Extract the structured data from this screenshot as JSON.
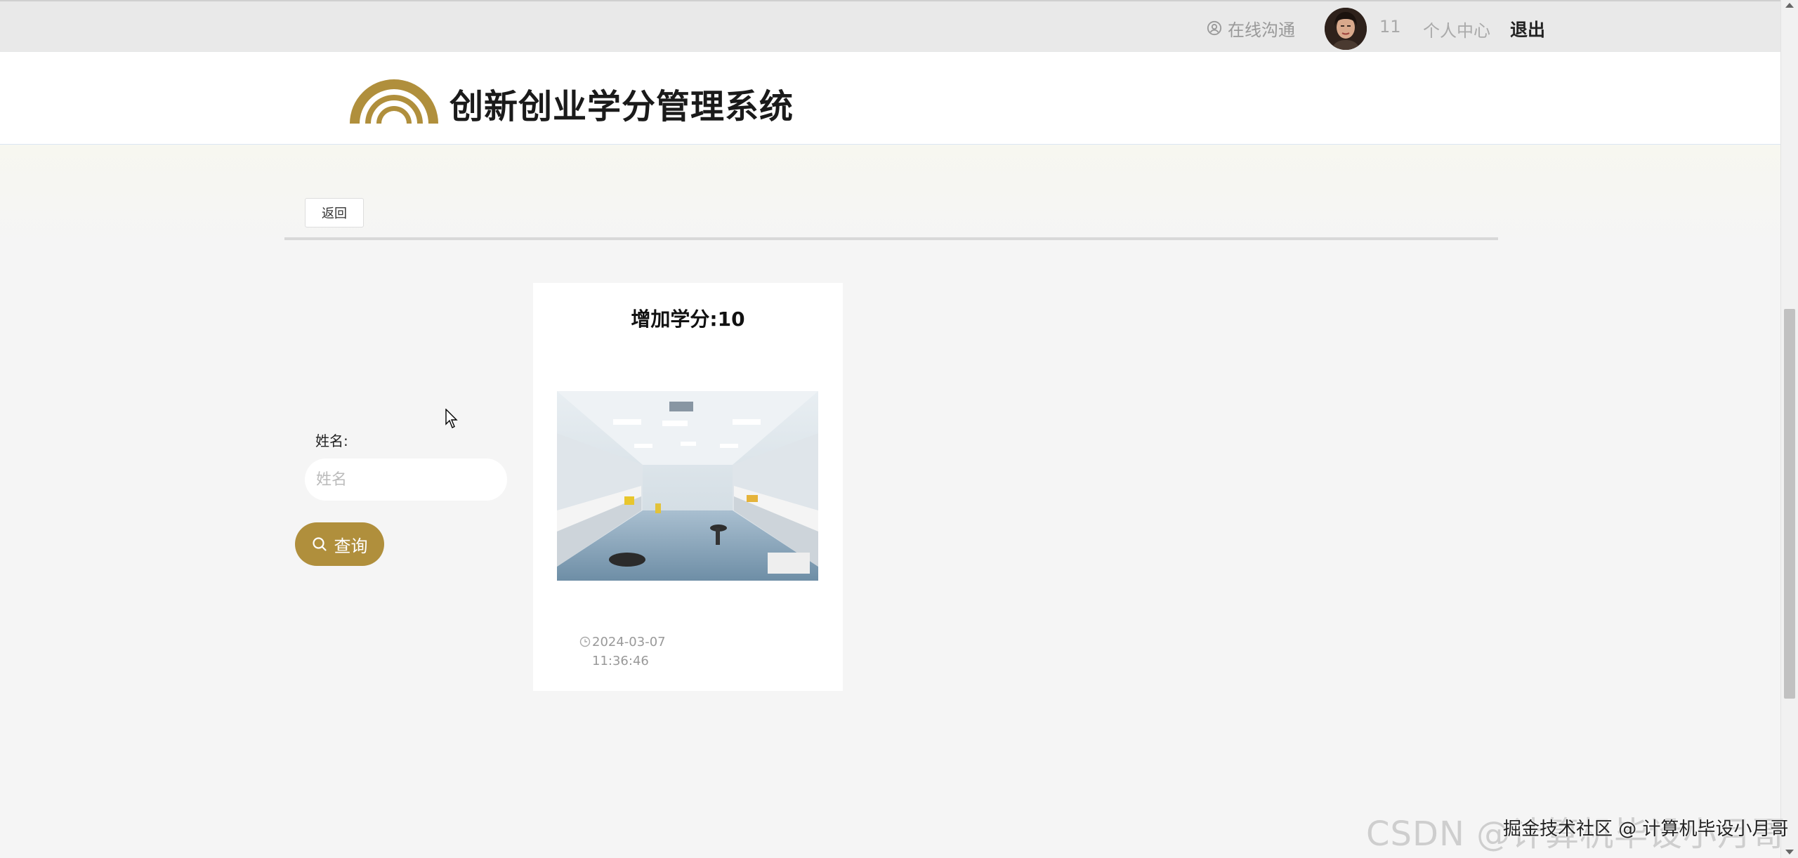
{
  "topbar": {
    "chat_label": "在线沟通",
    "username": "11",
    "center_label": "个人中心",
    "logout_label": "退出"
  },
  "header": {
    "site_title": "创新创业学分管理系统"
  },
  "toolbar": {
    "back_label": "返回"
  },
  "search": {
    "name_label": "姓名:",
    "name_placeholder": "姓名",
    "name_value": "",
    "query_label": "查询"
  },
  "card": {
    "title": "增加学分:10",
    "image_icon": "laboratory-photo",
    "date": "2024-03-07",
    "time": "11:36:46"
  },
  "watermark": {
    "large": "CSDN @计算机毕设小月哥",
    "small": "掘金技术社区 @ 计算机毕设小月哥"
  },
  "colors": {
    "accent": "#b08f3c",
    "topbar_bg": "#e9e9e9",
    "page_bg": "#f5f5f5"
  }
}
